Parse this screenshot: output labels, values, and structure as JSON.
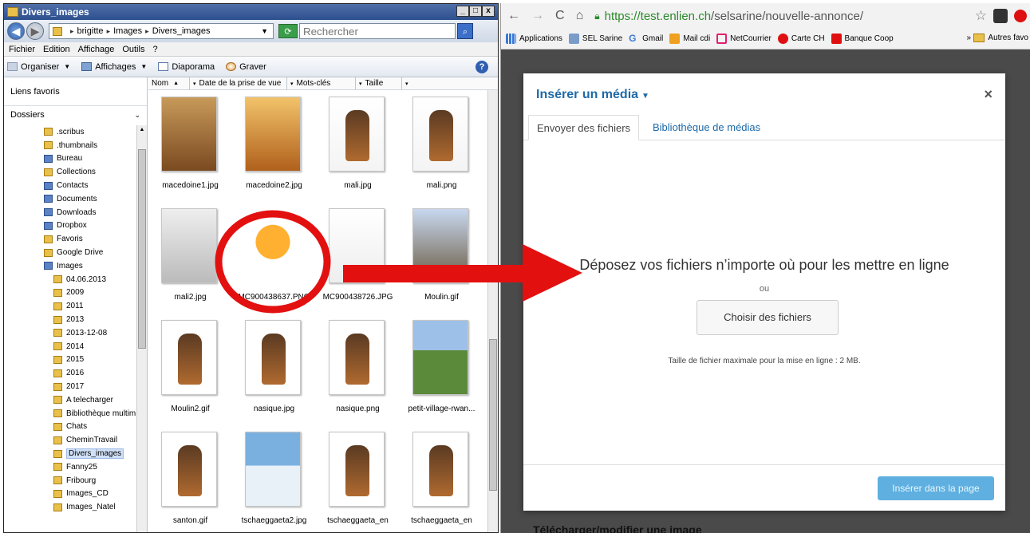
{
  "explorer": {
    "title": "Divers_images",
    "window_buttons": [
      "_",
      "□",
      "x"
    ],
    "address": {
      "crumbs": [
        "brigitte",
        "Images",
        "Divers_images"
      ],
      "search_placeholder": "Rechercher"
    },
    "menu": [
      "Fichier",
      "Edition",
      "Affichage",
      "Outils",
      "?"
    ],
    "toolbar": {
      "organiser": "Organiser",
      "affichages": "Affichages",
      "diaporama": "Diaporama",
      "graver": "Graver"
    },
    "favorites_label": "Liens favoris",
    "folders_label": "Dossiers",
    "tree": [
      ".scribus",
      ".thumbnails",
      "Bureau",
      "Collections",
      "Contacts",
      "Documents",
      "Downloads",
      "Dropbox",
      "Favoris",
      "Google Drive",
      "Images",
      "04.06.2013",
      "2009",
      "2011",
      "2013",
      "2013-12-08",
      "2014",
      "2015",
      "2016",
      "2017",
      "A telecharger",
      "Bibliothèque multim",
      "Chats",
      "CheminTravail",
      "Divers_images",
      "Fanny25",
      "Fribourg",
      "Images_CD",
      "Images_Natel"
    ],
    "selected_folder": "Divers_images",
    "columns": [
      "Nom",
      "Date de la prise de vue",
      "Mots-clés",
      "Taille"
    ],
    "files": [
      "macedoine1.jpg",
      "macedoine2.jpg",
      "mali.jpg",
      "mali.png",
      "mali2.jpg",
      "MC900438637.PNG",
      "MC900438726.JPG",
      "Moulin.gif",
      "Moulin2.gif",
      "nasique.jpg",
      "nasique.png",
      "petit-village-rwan...",
      "santon.gif",
      "tschaeggaeta2.jpg",
      "tschaeggaeta_en",
      "tschaeggaeta_en"
    ]
  },
  "browser": {
    "url_host": "https://test.enlien.ch",
    "url_path": "/selsarine/nouvelle-annonce/",
    "bookmarks": [
      "Applications",
      "SEL Sarine",
      "Gmail",
      "Mail cdi",
      "NetCourrier",
      "Carte CH",
      "Banque Coop"
    ],
    "bookmark_more": "»",
    "bookmark_others": "Autres favo",
    "modal": {
      "title": "Insérer un média",
      "close": "×",
      "tab_upload": "Envoyer des fichiers",
      "tab_library": "Bibliothèque de médias",
      "drop_text": "Déposez vos fichiers n’importe où pour les mettre en ligne",
      "or": "ou",
      "choose_button": "Choisir des fichiers",
      "max_size": "Taille de fichier maximale pour la mise en ligne : 2 MB.",
      "insert_button": "Insérer dans la page"
    },
    "bottom_text": "Télécharger/modifier une image"
  },
  "colors": {
    "annotation_red": "#e31010",
    "wp_link_blue": "#1e6aa8",
    "insert_button": "#5fb0e0"
  }
}
